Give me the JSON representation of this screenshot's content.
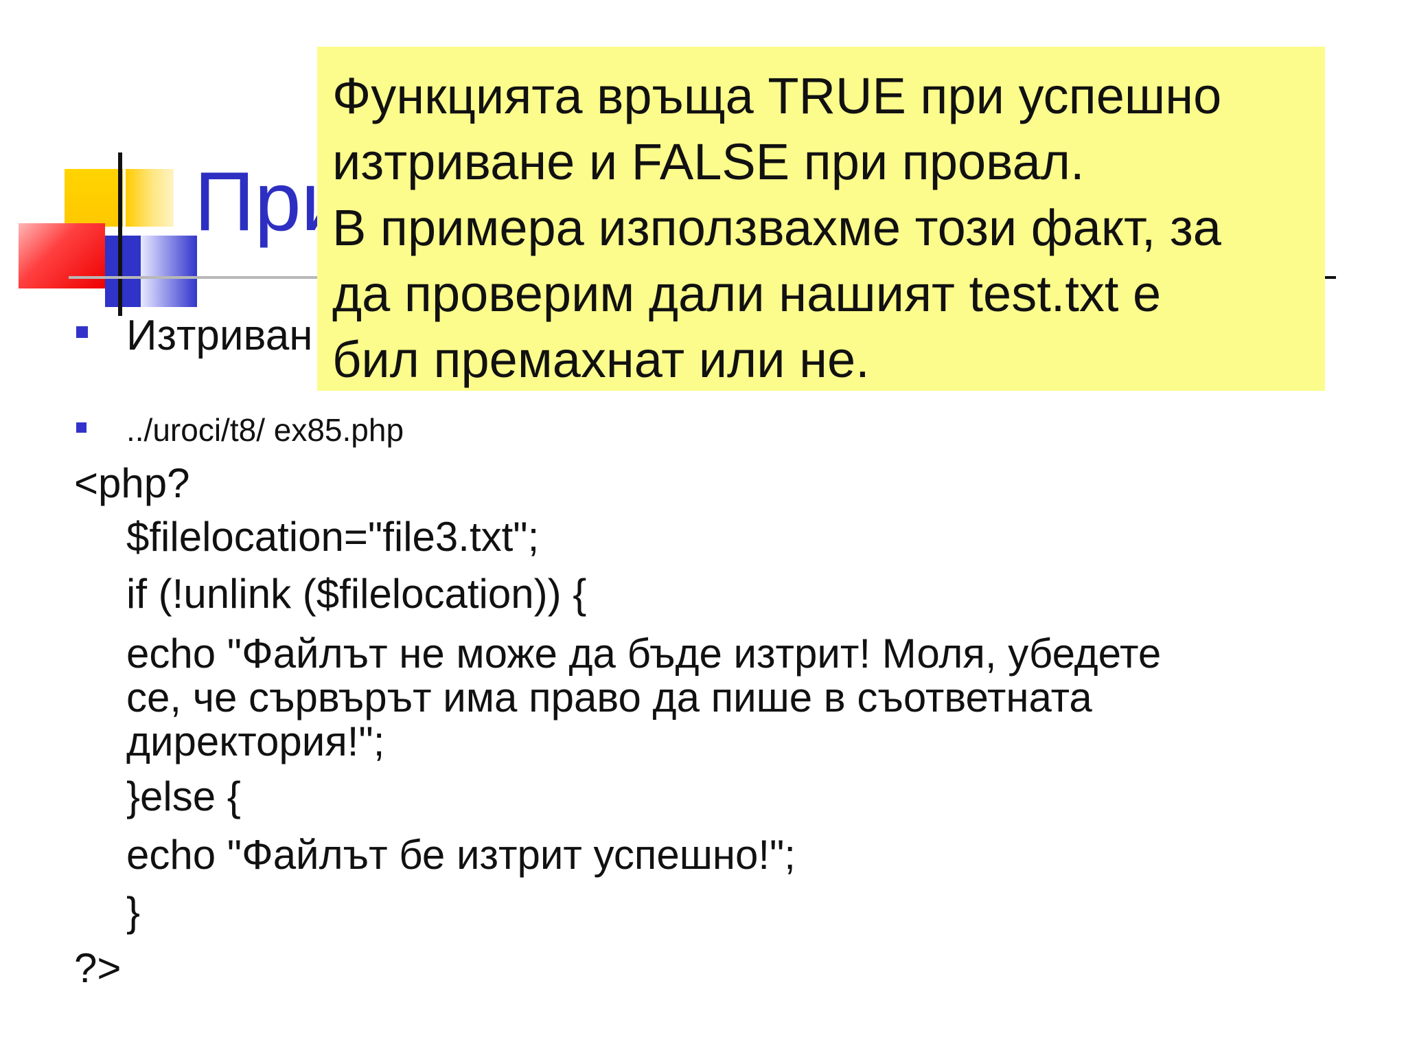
{
  "slide": {
    "title": "При",
    "bullets": [
      "Изтриван",
      "../uroci/t8/ ex85.php"
    ],
    "code": {
      "open": "<php?",
      "line1": "$filelocation=\"file3.txt\";",
      "line2": "if (!unlink ($filelocation)) {",
      "line3a": "echo \"Файлът не може да бъде изтрит! Моля, убедете",
      "line3b": "се, че сървърът има право да пише в съответната",
      "line3c": "директория!\";",
      "line4": "}else {",
      "line5": "echo \"Файлът бе изтрит успешно!\";",
      "line6": "}",
      "close": "?>"
    }
  },
  "callout": {
    "lines": [
      "Функцията връща TRUE при успешно",
      "изтриване и FALSE при провал.",
      "В примера използвахме този факт, за",
      "да проверим дали нашият test.txt е",
      "бил премахнат или не."
    ],
    "background_color": "#fcfc8c"
  },
  "colors": {
    "title": "#2d2fc2",
    "bullet": "#3333cc"
  }
}
